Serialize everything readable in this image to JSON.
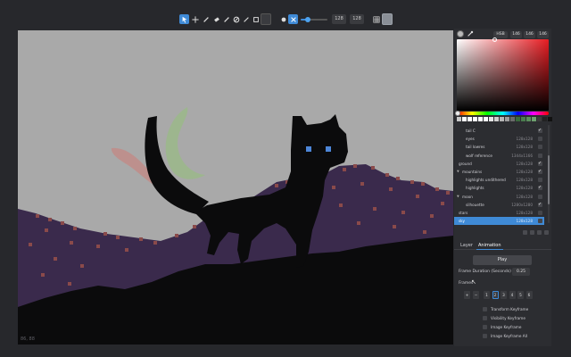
{
  "toolbar": {
    "tools": [
      "select-tool",
      "move-tool",
      "pencil-tool",
      "eraser-tool",
      "brush-tool",
      "fill-tool",
      "line-tool",
      "rectangle-tool"
    ],
    "active_tools": [
      "select-tool",
      "transform-tool"
    ],
    "brush_size": 0.25,
    "canvas_width": "128",
    "canvas_height": "128"
  },
  "canvas": {
    "coords_text": "86, 88"
  },
  "color_picker": {
    "mode": "HSB",
    "h": "146",
    "s": "146",
    "b": "146",
    "palette": [
      "#c9c9c9",
      "#ffffff",
      "#ffffff",
      "#ffffff",
      "#ffffff",
      "#ffffff",
      "#e6e6e6",
      "#cfcfcf",
      "#b6b6b6",
      "#9d9d9d",
      "#6b6b6b",
      "#3a6a3e",
      "#4a7d4e",
      "#5b8f5e",
      "#6ea06f",
      "#3d3d3d",
      "#222222",
      "#111111"
    ]
  },
  "layers": [
    {
      "name": "tail C",
      "size": "",
      "visible": true,
      "indent": 2
    },
    {
      "name": "eyes",
      "size": "128x128",
      "visible": false,
      "indent": 2
    },
    {
      "name": "tail lowres",
      "size": "128x128",
      "visible": false,
      "indent": 2
    },
    {
      "name": "wolf reference",
      "size": "1344x1166",
      "visible": false,
      "indent": 2
    },
    {
      "name": "ground",
      "size": "128x128",
      "visible": true,
      "indent": 0
    },
    {
      "name": "mountains",
      "size": "128x128",
      "visible": true,
      "indent": 0,
      "group": true
    },
    {
      "name": "highlights undithered",
      "size": "128x128",
      "visible": false,
      "indent": 2
    },
    {
      "name": "highlights",
      "size": "128x128",
      "visible": true,
      "indent": 2
    },
    {
      "name": "moon",
      "size": "128x128",
      "visible": false,
      "indent": 0,
      "group": true
    },
    {
      "name": "silhouette",
      "size": "1280x1280",
      "visible": true,
      "indent": 2
    },
    {
      "name": "stars",
      "size": "128x128",
      "visible": false,
      "indent": 0
    },
    {
      "name": "sky",
      "size": "128x128",
      "visible": false,
      "indent": 0,
      "selected": true
    }
  ],
  "tabs": [
    "Layer",
    "Animation"
  ],
  "animation": {
    "play_label": "Play",
    "frame_duration_label": "Frame Duration (Seconds)",
    "frame_duration_value": "0.25",
    "frames_label": "Frames",
    "frames": [
      "1",
      "2",
      "3",
      "4",
      "5",
      "6"
    ],
    "current_frame": "2",
    "keyframes": [
      "Transform Keyframe",
      "Visibility Keyframe",
      "Image Keyframe",
      "Image Keyframe All"
    ]
  },
  "colors": {
    "accent": "#3f8ad6",
    "sky": "#a9a9a9",
    "mountain": "#3a2a4c",
    "dither": "#8a4a4a",
    "silhouette": "#0b0b0c",
    "moon": "#9bb88a",
    "eyes": "#4d86d8"
  }
}
